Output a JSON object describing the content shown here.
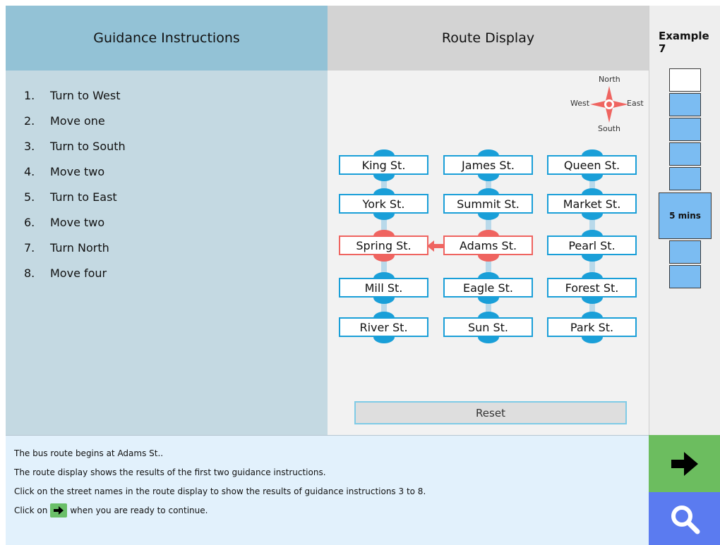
{
  "guidance": {
    "title": "Guidance Instructions",
    "items": [
      {
        "num": "1.",
        "text": "Turn to West"
      },
      {
        "num": "2.",
        "text": "Move one"
      },
      {
        "num": "3.",
        "text": "Turn to South"
      },
      {
        "num": "4.",
        "text": "Move two"
      },
      {
        "num": "5.",
        "text": "Turn to East"
      },
      {
        "num": "6.",
        "text": "Move two"
      },
      {
        "num": "7.",
        "text": "Turn North"
      },
      {
        "num": "8.",
        "text": "Move four"
      }
    ]
  },
  "route": {
    "title": "Route Display",
    "compass": {
      "north": "North",
      "south": "South",
      "east": "East",
      "west": "West"
    },
    "streets": [
      [
        "King St.",
        "James St.",
        "Queen St."
      ],
      [
        "York St.",
        "Summit St.",
        "Market St."
      ],
      [
        "Spring St.",
        "Adams St.",
        "Pearl St."
      ],
      [
        "Mill St.",
        "Eagle St.",
        "Forest St."
      ],
      [
        "River St.",
        "Sun St.",
        "Park St."
      ]
    ],
    "highlighted": [
      "Spring St.",
      "Adams St."
    ],
    "reset_label": "Reset"
  },
  "progress": {
    "title": "Example 7",
    "current_label": "5 mins"
  },
  "footer": {
    "line1": "The bus route begins at Adams St..",
    "line2": "The route display shows the results of the first two guidance instructions.",
    "line3": "Click on the street names in the route display to show the results of guidance instructions 3 to 8.",
    "line4_before": "Click on",
    "line4_after": "when you are ready to continue."
  },
  "colors": {
    "active": "#ef6460",
    "street_border": "#1a9fd8",
    "next_button": "#6cbd5f",
    "zoom_button": "#5b7bf0"
  },
  "icons": [
    "arrow-right-icon",
    "search-icon",
    "compass-icon",
    "arrow-left-icon"
  ]
}
